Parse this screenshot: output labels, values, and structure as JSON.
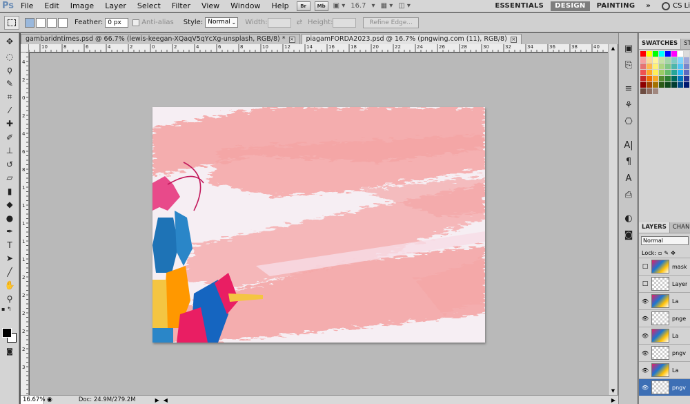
{
  "app": {
    "logo": "Ps"
  },
  "menu": [
    "File",
    "Edit",
    "Image",
    "Layer",
    "Select",
    "Filter",
    "View",
    "Window",
    "Help"
  ],
  "menubar_tools": {
    "br": "Br",
    "mb": "Mb",
    "zoom_value": "16.7"
  },
  "workspaces": {
    "essentials": "ESSENTIALS",
    "design": "DESIGN",
    "painting": "PAINTING",
    "more": "»",
    "cs_live": "CS Li"
  },
  "options": {
    "feather_label": "Feather:",
    "feather_value": "0 px",
    "antialias_label": "Anti-alias",
    "style_label": "Style:",
    "style_value": "Normal",
    "width_label": "Width:",
    "height_label": "Height:",
    "refine_edge": "Refine Edge..."
  },
  "tabs": [
    {
      "label": "gambaridntimes.psd @ 66.7% (lewis-keegan-XQaqV5qYcXg-unsplash, RGB/8) *",
      "close": "×"
    },
    {
      "label": "piagamFORDA2023.psd @ 16.7% (pngwing.com (11), RGB/8)",
      "close": "×"
    }
  ],
  "ruler_top": [
    "10",
    "8",
    "6",
    "4",
    "2",
    "0",
    "2",
    "4",
    "6",
    "8",
    "10",
    "12",
    "14",
    "16",
    "18",
    "20",
    "22",
    "24",
    "26",
    "28",
    "30",
    "32",
    "34",
    "36",
    "38",
    "40"
  ],
  "ruler_left": [
    "4",
    "2",
    "0",
    "2",
    "4",
    "6",
    "8",
    "1",
    "1",
    "1",
    "1",
    "1",
    "2",
    "2",
    "2",
    "2",
    "2",
    "3"
  ],
  "status": {
    "zoom": "16.67%",
    "doc": "Doc: 24.9M/279.2M"
  },
  "panels": {
    "swatches_tab": "SWATCHES",
    "styles_tab": "STY",
    "layers_tab": "LAYERS",
    "channels_tab": "CHANN",
    "blend_mode": "Normal",
    "lock_label": "Lock:"
  },
  "layers": [
    {
      "name": "mask",
      "thumb": "art",
      "visible": false,
      "selected": false
    },
    {
      "name": "Layer",
      "thumb": "empty",
      "visible": false,
      "selected": false
    },
    {
      "name": "La",
      "thumb": "art",
      "visible": true,
      "selected": false
    },
    {
      "name": "pnge",
      "thumb": "empty",
      "visible": true,
      "selected": false
    },
    {
      "name": "La",
      "thumb": "art",
      "visible": true,
      "selected": false
    },
    {
      "name": "pngv",
      "thumb": "empty",
      "visible": true,
      "selected": false
    },
    {
      "name": "La",
      "thumb": "art",
      "visible": true,
      "selected": false
    },
    {
      "name": "pngv",
      "thumb": "empty",
      "visible": true,
      "selected": true
    }
  ],
  "colors": {
    "accent": "#3d6fb5",
    "canvas_bg": "#b9b9b9",
    "brush_pink": "#f4a6a6"
  }
}
